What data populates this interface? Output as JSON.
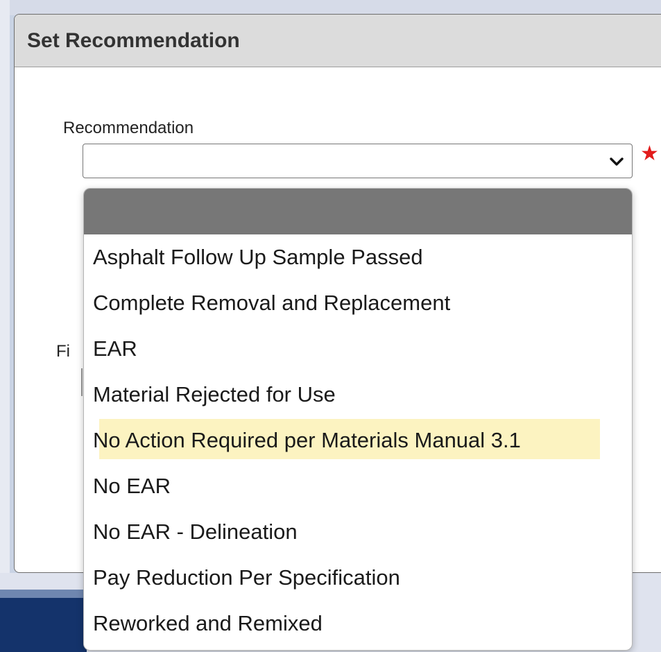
{
  "dialog": {
    "title": "Set Recommendation"
  },
  "recommendation_field": {
    "label": "Recommendation",
    "selected_value": "",
    "required_marker": "★"
  },
  "obscured_field": {
    "label_fragment": "Fi"
  },
  "dropdown": {
    "highlighted_index": 5,
    "options": [
      "",
      "Asphalt Follow Up Sample Passed",
      "Complete Removal and Replacement",
      "EAR",
      "Material Rejected for Use",
      "No Action Required per Materials Manual 3.1",
      "No EAR",
      "No EAR - Delineation",
      "Pay Reduction Per Specification",
      "Reworked and Remixed"
    ]
  },
  "colors": {
    "highlight": "#fcf3c1",
    "required": "#e21b1b",
    "header_bg": "#dcdcdc",
    "empty_option_bg": "#777777"
  },
  "icons": {
    "select_arrow": "chevron-down-icon",
    "required": "star-icon"
  }
}
